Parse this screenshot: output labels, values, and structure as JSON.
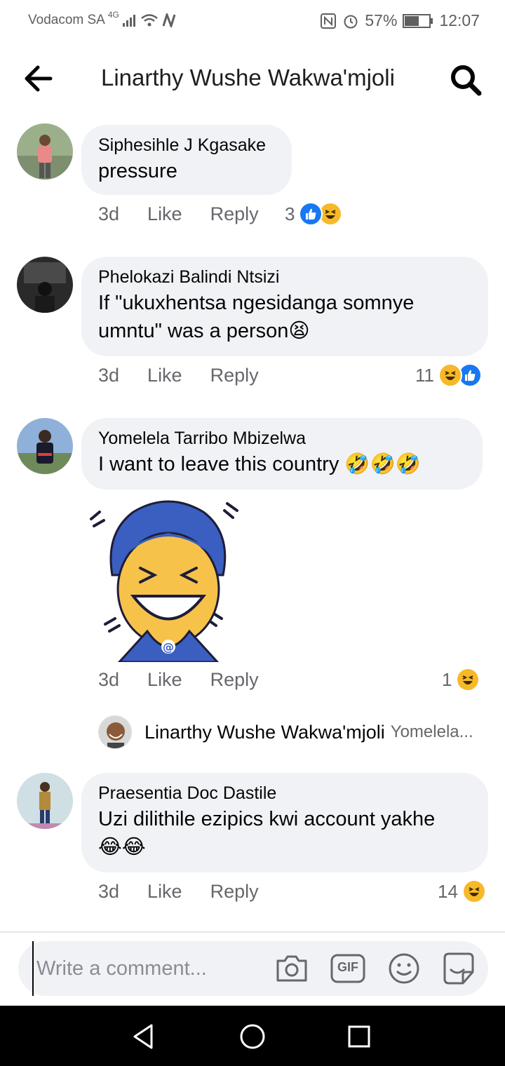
{
  "status_bar": {
    "carrier": "Vodacom SA",
    "network": "4G",
    "battery": "57%",
    "time": "12:07"
  },
  "header": {
    "title": "Linarthy Wushe Wakwa'mjoli"
  },
  "comments": [
    {
      "author": "Siphesihle J Kgasake",
      "text": "pressure",
      "age": "3d",
      "like_label": "Like",
      "reply_label": "Reply",
      "reaction_count": "3",
      "reactions": [
        "like-icon",
        "laugh-icon"
      ]
    },
    {
      "author": "Phelokazi Balindi Ntsizi",
      "text_line1": "If \"ukuxhentsa ngesidanga somnye",
      "text_line2": "umntu\" was a person😫",
      "age": "3d",
      "like_label": "Like",
      "reply_label": "Reply",
      "reaction_count": "11",
      "reactions": [
        "laugh-icon",
        "like-icon"
      ]
    },
    {
      "author": "Yomelela Tarribo Mbizelwa",
      "text": "I want to leave this country 🤣🤣🤣",
      "age": "3d",
      "like_label": "Like",
      "reply_label": "Reply",
      "reaction_count": "1",
      "reactions": [
        "laugh-icon"
      ],
      "reply_preview": {
        "author": "Linarthy Wushe Wakwa'mjoli",
        "text": "Yomelela..."
      }
    },
    {
      "author": "Praesentia Doc Dastile",
      "text_line1": "Uzi dilithile ezipics kwi account yakhe",
      "text_line2": "😂😂",
      "age": "3d",
      "like_label": "Like",
      "reply_label": "Reply",
      "reaction_count": "14",
      "reactions": [
        "laugh-icon"
      ]
    }
  ],
  "composer": {
    "placeholder": "Write a comment...",
    "gif_label": "GIF"
  },
  "colors": {
    "bubble_bg": "#f0f2f5",
    "meta_text": "#65676b",
    "like_blue": "#1877f2",
    "laugh_yellow": "#f7b928",
    "navbar_bg": "#000000"
  }
}
